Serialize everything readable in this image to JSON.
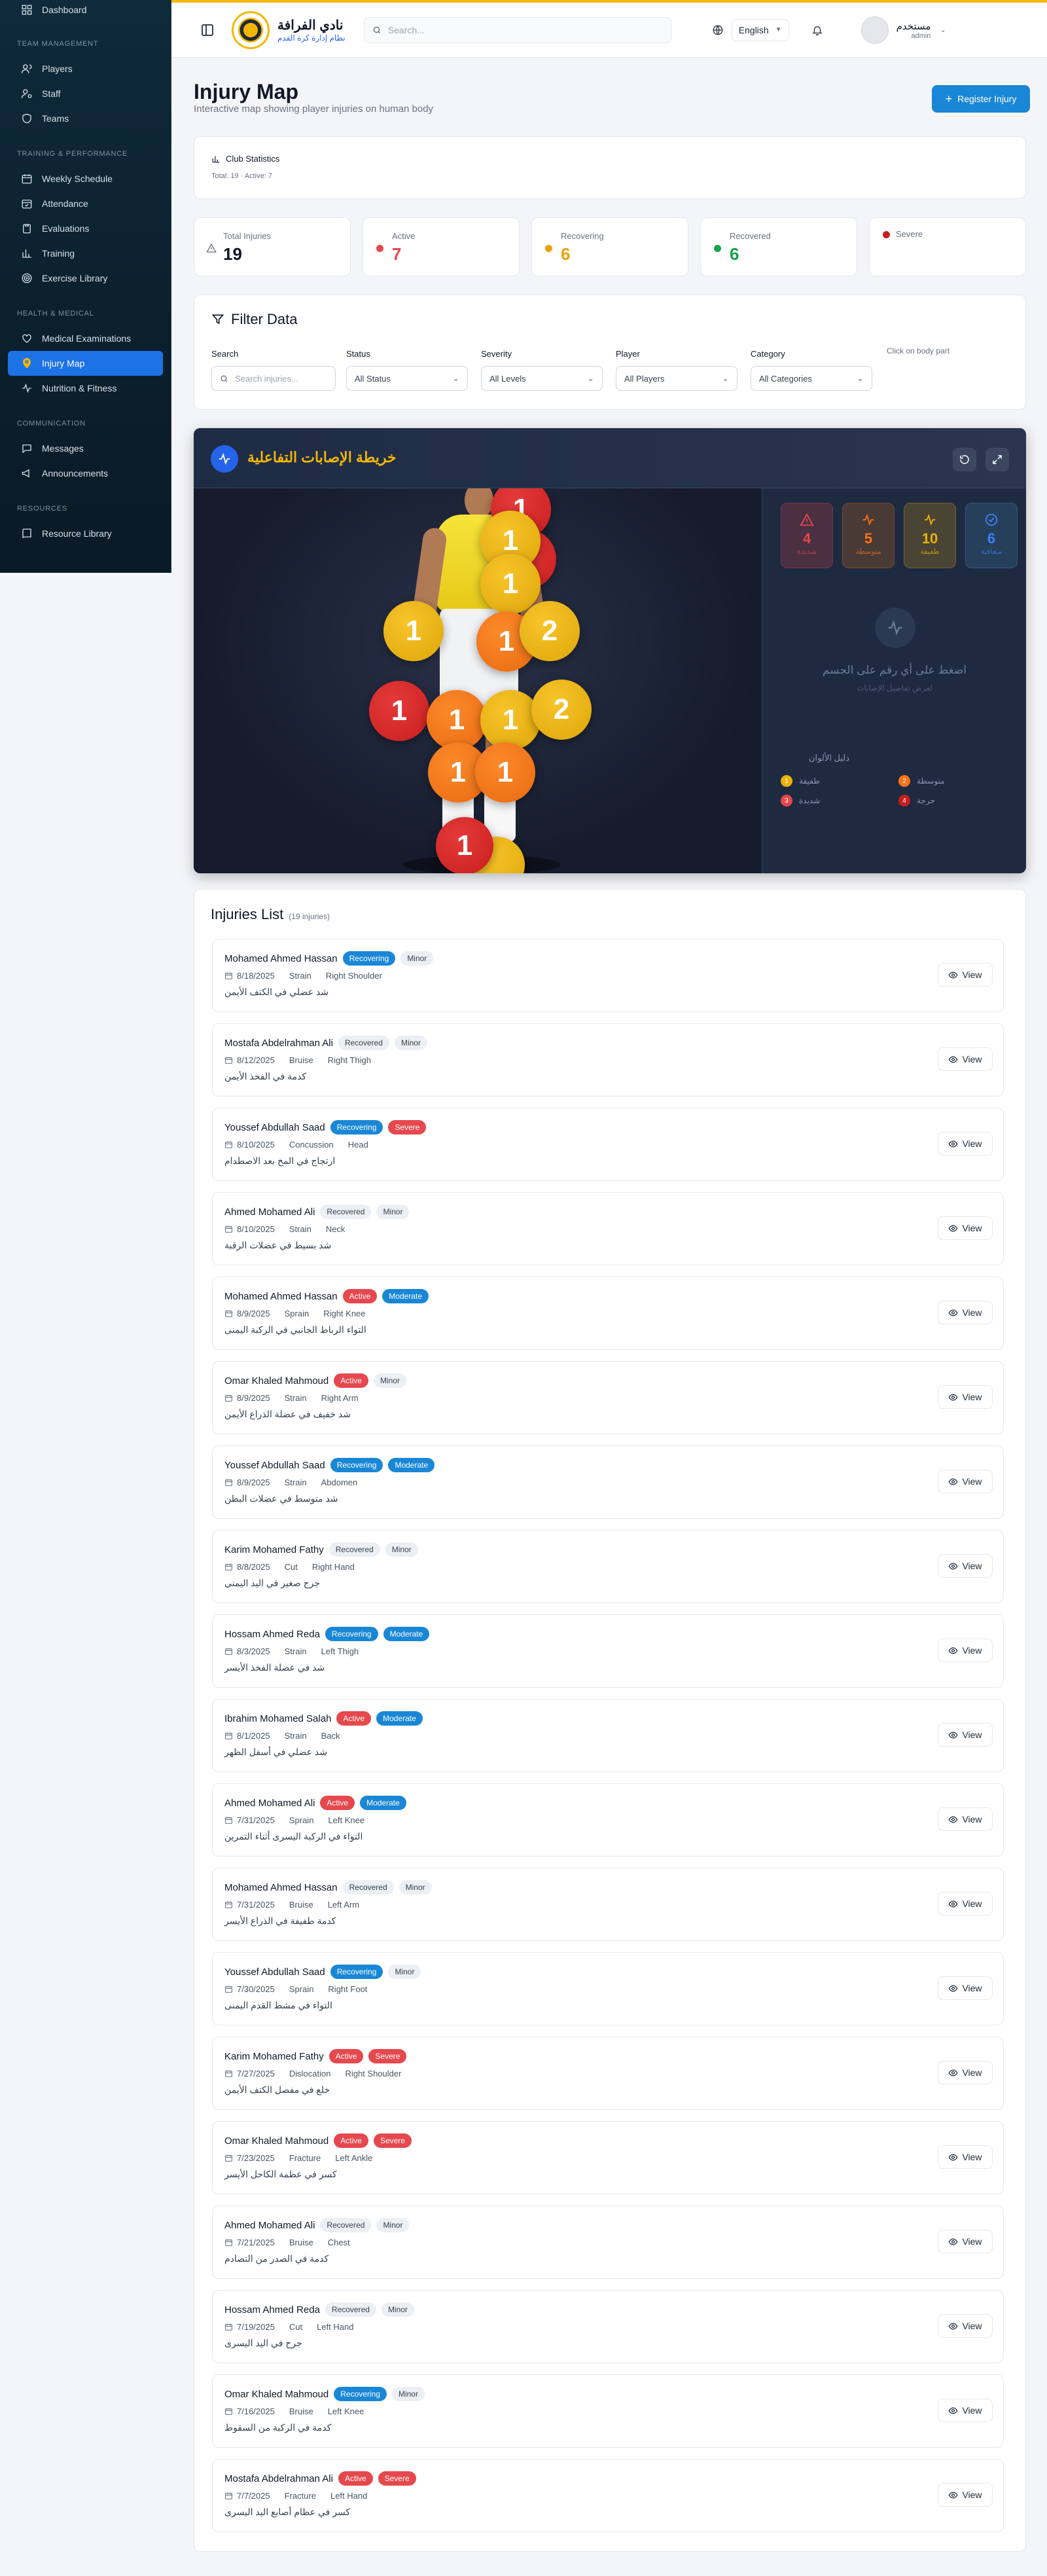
{
  "sidebar": {
    "top_item": "Dashboard",
    "sections": [
      {
        "title": "TEAM MANAGEMENT",
        "items": [
          "Players",
          "Staff",
          "Teams"
        ]
      },
      {
        "title": "TRAINING & PERFORMANCE",
        "items": [
          "Weekly Schedule",
          "Attendance",
          "Evaluations",
          "Training",
          "Exercise Library"
        ]
      },
      {
        "title": "HEALTH & MEDICAL",
        "items": [
          "Medical Examinations",
          "Injury Map",
          "Nutrition & Fitness"
        ]
      },
      {
        "title": "COMMUNICATION",
        "items": [
          "Messages",
          "Announcements"
        ]
      },
      {
        "title": "RESOURCES",
        "items": [
          "Resource Library"
        ]
      }
    ],
    "active_item": "Injury Map"
  },
  "topbar": {
    "club_name": "نادي الفرافة",
    "club_subtitle": "نظام إدارة كرة القدم",
    "search_placeholder": "Search...",
    "language": "English",
    "user_name": "مستخدم",
    "user_role": "admin"
  },
  "page": {
    "title": "Injury Map",
    "subtitle": "Interactive map showing player injuries on human body",
    "register_button": "Register Injury"
  },
  "club_stats": {
    "title": "Club Statistics",
    "summary": "Total: 19 · Active: 7"
  },
  "stat_cards": [
    {
      "label": "Total Injuries",
      "value": "19",
      "color": "#6b7280"
    },
    {
      "label": "Active",
      "value": "7",
      "color": "#e5484d"
    },
    {
      "label": "Recovering",
      "value": "6",
      "color": "#e9a20b"
    },
    {
      "label": "Recovered",
      "value": "6",
      "color": "#16a34a"
    },
    {
      "label": "Severe",
      "value": "",
      "color": "#c81e1e"
    }
  ],
  "filter": {
    "title": "Filter Data",
    "search_label": "Search",
    "search_placeholder": "Search injuries...",
    "status_label": "Status",
    "status_value": "All Status",
    "severity_label": "Severity",
    "severity_value": "All Levels",
    "player_label": "Player",
    "player_value": "All Players",
    "category_label": "Category",
    "category_value": "All Categories",
    "hint": "Click on body part"
  },
  "map": {
    "title": "خريطة الإصابات التفاعلية",
    "stats": [
      {
        "value": "4",
        "label": "شديدة",
        "color": "#e5484d"
      },
      {
        "value": "5",
        "label": "متوسطة",
        "color": "#f97316"
      },
      {
        "value": "10",
        "label": "طفيفة",
        "color": "#eab308"
      },
      {
        "value": "6",
        "label": "متعافية",
        "color": "#3b82f6"
      }
    ],
    "empty_text": "اضغط على أي رقم على الجسم",
    "empty_subtext": "لعرض تفاصيل الإصابات",
    "legend_title": "دليل الألوان",
    "legend": [
      {
        "label": "طفيفة",
        "color": "#eab308",
        "num": "1"
      },
      {
        "label": "متوسطة",
        "color": "#f97316",
        "num": "2"
      },
      {
        "label": "شديدة",
        "color": "#e5484d",
        "num": "3"
      },
      {
        "label": "حرجة",
        "color": "#c81e1e",
        "num": "4"
      }
    ],
    "markers": [
      "1",
      "1",
      "1",
      "1",
      "1",
      "1",
      "2",
      "1",
      "1",
      "1",
      "2",
      "1",
      "1",
      "1"
    ]
  },
  "injuries": {
    "title": "Injuries List",
    "count": "(19 injuries)",
    "view_label": "View",
    "items": [
      {
        "name": "Mohamed Ahmed Hassan",
        "status": "Recovering",
        "severity": "Minor",
        "date": "8/18/2025",
        "type": "Strain",
        "location": "Right Shoulder",
        "desc": "شد عضلي في الكتف الأيمن"
      },
      {
        "name": "Mostafa Abdelrahman Ali",
        "status": "Recovered",
        "severity": "Minor",
        "date": "8/12/2025",
        "type": "Bruise",
        "location": "Right Thigh",
        "desc": "كدمة في الفخذ الأيمن"
      },
      {
        "name": "Youssef Abdullah Saad",
        "status": "Recovering",
        "severity": "Severe",
        "date": "8/10/2025",
        "type": "Concussion",
        "location": "Head",
        "desc": "ارتجاج في المخ بعد الاصطدام"
      },
      {
        "name": "Ahmed Mohamed Ali",
        "status": "Recovered",
        "severity": "Minor",
        "date": "8/10/2025",
        "type": "Strain",
        "location": "Neck",
        "desc": "شد بسيط في عضلات الرقبة"
      },
      {
        "name": "Mohamed Ahmed Hassan",
        "status": "Active",
        "severity": "Moderate",
        "date": "8/9/2025",
        "type": "Sprain",
        "location": "Right Knee",
        "desc": "التواء الرباط الجانبي في الركبة اليمنى"
      },
      {
        "name": "Omar Khaled Mahmoud",
        "status": "Active",
        "severity": "Minor",
        "date": "8/9/2025",
        "type": "Strain",
        "location": "Right Arm",
        "desc": "شد خفيف في عضلة الذراع الأيمن"
      },
      {
        "name": "Youssef Abdullah Saad",
        "status": "Recovering",
        "severity": "Moderate",
        "date": "8/9/2025",
        "type": "Strain",
        "location": "Abdomen",
        "desc": "شد متوسط في عضلات البطن"
      },
      {
        "name": "Karim Mohamed Fathy",
        "status": "Recovered",
        "severity": "Minor",
        "date": "8/8/2025",
        "type": "Cut",
        "location": "Right Hand",
        "desc": "جرح صغير في اليد اليمنى"
      },
      {
        "name": "Hossam Ahmed Reda",
        "status": "Recovering",
        "severity": "Moderate",
        "date": "8/3/2025",
        "type": "Strain",
        "location": "Left Thigh",
        "desc": "شد في عضلة الفخذ الأيسر"
      },
      {
        "name": "Ibrahim Mohamed Salah",
        "status": "Active",
        "severity": "Moderate",
        "date": "8/1/2025",
        "type": "Strain",
        "location": "Back",
        "desc": "شد عضلي في أسفل الظهر"
      },
      {
        "name": "Ahmed Mohamed Ali",
        "status": "Active",
        "severity": "Moderate",
        "date": "7/31/2025",
        "type": "Sprain",
        "location": "Left Knee",
        "desc": "التواء في الركبة اليسرى أثناء التمرين"
      },
      {
        "name": "Mohamed Ahmed Hassan",
        "status": "Recovered",
        "severity": "Minor",
        "date": "7/31/2025",
        "type": "Bruise",
        "location": "Left Arm",
        "desc": "كدمة طفيفة في الذراع الأيسر"
      },
      {
        "name": "Youssef Abdullah Saad",
        "status": "Recovering",
        "severity": "Minor",
        "date": "7/30/2025",
        "type": "Sprain",
        "location": "Right Foot",
        "desc": "التواء في مشط القدم اليمنى"
      },
      {
        "name": "Karim Mohamed Fathy",
        "status": "Active",
        "severity": "Severe",
        "date": "7/27/2025",
        "type": "Dislocation",
        "location": "Right Shoulder",
        "desc": "خلع في مفصل الكتف الأيمن"
      },
      {
        "name": "Omar Khaled Mahmoud",
        "status": "Active",
        "severity": "Severe",
        "date": "7/23/2025",
        "type": "Fracture",
        "location": "Left Ankle",
        "desc": "كسر في عظمة الكاحل الأيسر"
      },
      {
        "name": "Ahmed Mohamed Ali",
        "status": "Recovered",
        "severity": "Minor",
        "date": "7/21/2025",
        "type": "Bruise",
        "location": "Chest",
        "desc": "كدمة في الصدر من التصادم"
      },
      {
        "name": "Hossam Ahmed Reda",
        "status": "Recovered",
        "severity": "Minor",
        "date": "7/19/2025",
        "type": "Cut",
        "location": "Left Hand",
        "desc": "جرح في اليد اليسرى"
      },
      {
        "name": "Omar Khaled Mahmoud",
        "status": "Recovering",
        "severity": "Minor",
        "date": "7/16/2025",
        "type": "Bruise",
        "location": "Left Knee",
        "desc": "كدمة في الركبة من السقوط"
      },
      {
        "name": "Mostafa Abdelrahman Ali",
        "status": "Active",
        "severity": "Severe",
        "date": "7/7/2025",
        "type": "Fracture",
        "location": "Left Hand",
        "desc": "كسر في عظام أصابع اليد اليسرى"
      }
    ]
  }
}
